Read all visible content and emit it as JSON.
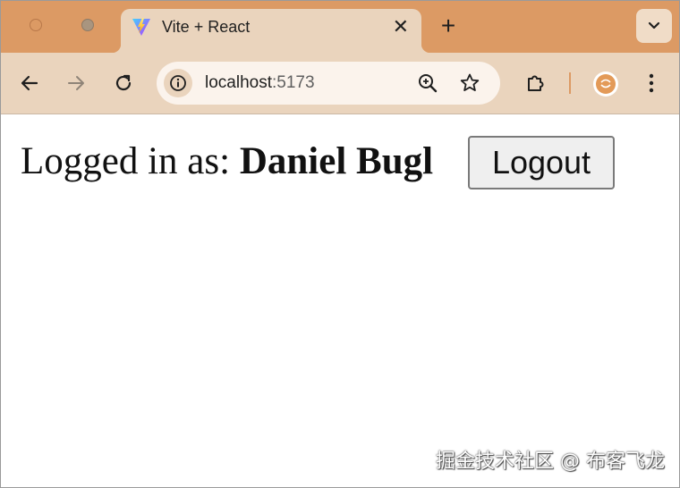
{
  "tab": {
    "title": "Vite + React",
    "favicon_icon": "vite-logo-icon",
    "close_icon": "close-icon"
  },
  "tabstrip": {
    "new_tab_label": "+",
    "tab_search_icon": "chevron-down-icon"
  },
  "toolbar": {
    "back_icon": "arrow-left-icon",
    "forward_icon": "arrow-right-icon",
    "reload_icon": "reload-icon",
    "address": {
      "host": "localhost",
      "port": ":5173",
      "site_info_icon": "info-icon",
      "zoom_icon": "zoom-in-icon",
      "bookmark_icon": "star-icon"
    },
    "extensions_icon": "puzzle-icon",
    "profile_icon": "avatar",
    "menu_icon": "kebab-menu-icon"
  },
  "page": {
    "logged_prefix": "Logged in as: ",
    "username": "Daniel Bugl",
    "logout_label": "Logout"
  },
  "watermark": "掘金技术社区 @ 布客飞龙",
  "colors": {
    "tabstrip_bg": "#dc9a64",
    "toolbar_bg": "#ead4bd",
    "omnibox_bg": "#fbf3ec",
    "page_bg": "#ffffff"
  }
}
